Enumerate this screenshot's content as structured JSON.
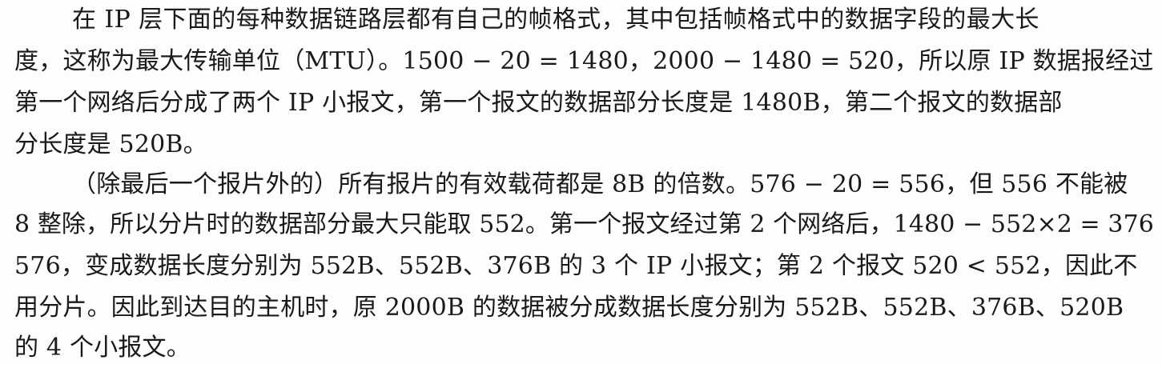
{
  "paragraphs": [
    {
      "lines": [
        "在 IP 层下面的每种数据链路层都有自己的帧格式，其中包括帧格式中的数据字段的最大长",
        "度，这称为最大传输单位（MTU）。1500 − 20 = 1480，2000 − 1480 = 520，所以原 IP 数据报经过",
        "第一个网络后分成了两个 IP 小报文，第一个报文的数据部分长度是 1480B，第二个报文的数据部",
        "分长度是 520B。"
      ]
    },
    {
      "lines": [
        "（除最后一个报片外的）所有报片的有效载荷都是 8B 的倍数。576 − 20 = 556，但 556 不能被",
        "8 整除，所以分片时的数据部分最大只能取 552。第一个报文经过第 2 个网络后，1480 − 552×2 = 376 <",
        "576，变成数据长度分别为 552B、552B、376B 的 3 个 IP 小报文；第 2 个报文 520 < 552，因此不",
        "用分片。因此到达目的主机时，原 2000B 的数据被分成数据长度分别为 552B、552B、376B、520B",
        "的 4 个小报文。"
      ]
    }
  ]
}
